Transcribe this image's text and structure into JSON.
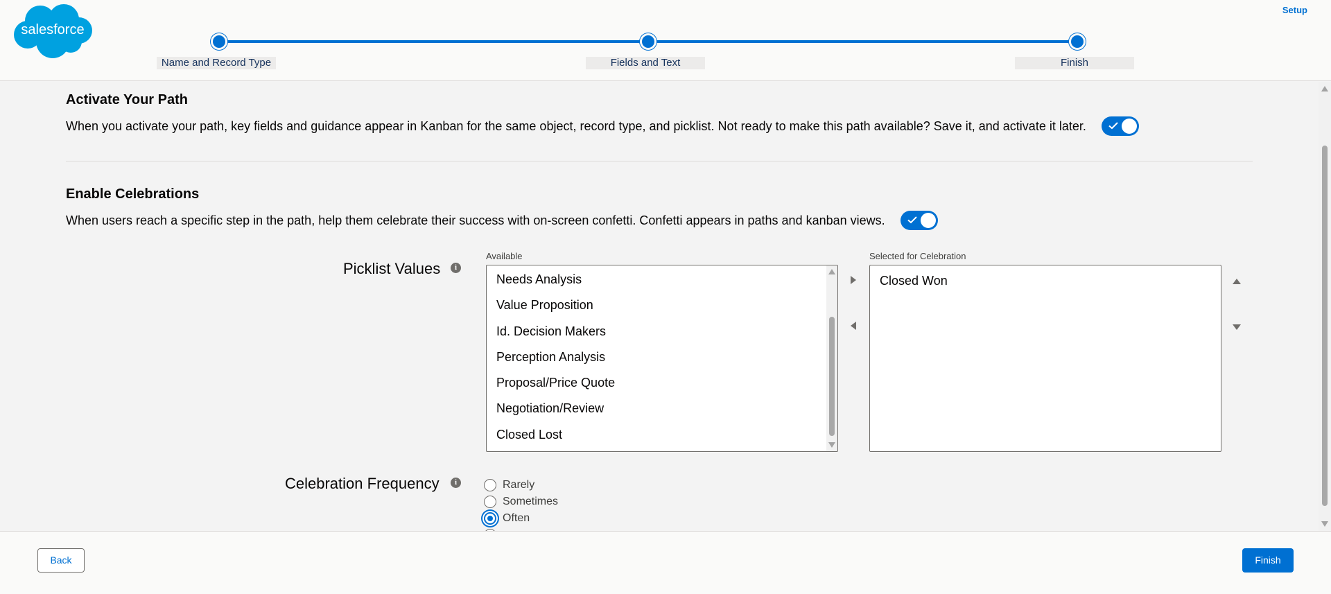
{
  "header": {
    "logo_text": "salesforce",
    "setup_link": "Setup",
    "steps": [
      {
        "label": "Name and Record Type"
      },
      {
        "label": "Fields and Text"
      },
      {
        "label": "Finish"
      }
    ]
  },
  "activate": {
    "title": "Activate Your Path",
    "description": "When you activate your path, key fields and guidance appear in Kanban for the same object, record type, and picklist. Not ready to make this path available? Save it, and activate it later.",
    "toggle_on": true
  },
  "celebrations": {
    "title": "Enable Celebrations",
    "description": "When users reach a specific step in the path, help them celebrate their success with on-screen confetti. Confetti appears in paths and kanban views.",
    "toggle_on": true
  },
  "picklist": {
    "label": "Picklist Values",
    "available_label": "Available",
    "available_items": [
      "Needs Analysis",
      "Value Proposition",
      "Id. Decision Makers",
      "Perception Analysis",
      "Proposal/Price Quote",
      "Negotiation/Review",
      "Closed Lost"
    ],
    "selected_label": "Selected for Celebration",
    "selected_items": [
      "Closed Won"
    ]
  },
  "frequency": {
    "label": "Celebration Frequency",
    "options": [
      "Rarely",
      "Sometimes",
      "Often"
    ],
    "selected": "Often"
  },
  "footer": {
    "back_label": "Back",
    "finish_label": "Finish"
  },
  "colors": {
    "brand": "#0070d2",
    "logo": "#00a1e0"
  },
  "icons": {
    "info": "info-icon",
    "check": "check-icon",
    "move_right": "move-right-icon",
    "move_left": "move-left-icon",
    "move_up": "move-up-icon",
    "move_down": "move-down-icon"
  }
}
